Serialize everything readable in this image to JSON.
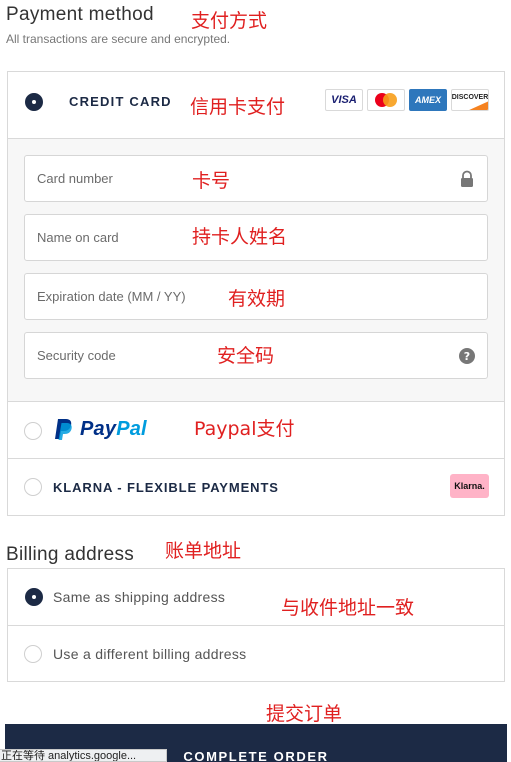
{
  "payment": {
    "title": "Payment method",
    "subtitle": "All transactions are secure and encrypted.",
    "credit_card": {
      "label": "CREDIT CARD",
      "selected": true,
      "logos": [
        {
          "name": "VISA",
          "color": "#1a1f71"
        },
        {
          "name": "mastercard",
          "color": "#eb001b"
        },
        {
          "name": "AMEX",
          "color": "#2e77bc"
        },
        {
          "name": "DISCOVER",
          "color": "#f58220"
        }
      ],
      "fields": {
        "card_number": {
          "placeholder": "Card number",
          "icon": "lock-icon"
        },
        "name_on_card": {
          "placeholder": "Name on card"
        },
        "expiration": {
          "placeholder": "Expiration date (MM / YY)"
        },
        "security_code": {
          "placeholder": "Security code",
          "icon": "help-icon"
        }
      }
    },
    "paypal": {
      "label_pay": "Pay",
      "label_pal": "Pal",
      "selected": false
    },
    "klarna": {
      "label": "KLARNA - FLEXIBLE PAYMENTS",
      "badge": "Klarna.",
      "selected": false
    }
  },
  "billing": {
    "title": "Billing address",
    "options": [
      {
        "label": "Same as shipping address",
        "selected": true
      },
      {
        "label": "Use a different billing address",
        "selected": false
      }
    ]
  },
  "submit": {
    "label": "COMPLETE ORDER"
  },
  "status_bar": {
    "text": "正在等待 analytics.google..."
  },
  "annotations": {
    "payment_method": "支付方式",
    "credit_card": "信用卡支付",
    "card_number": "卡号",
    "name_on_card": "持卡人姓名",
    "expiration": "有效期",
    "security_code": "安全码",
    "paypal": "Paypal支付",
    "billing_address": "账单地址",
    "same_as_shipping": "与收件地址一致",
    "submit": "提交订单"
  },
  "colors": {
    "navy": "#1c2a45",
    "annotation": "#e02020",
    "border": "#d9d9d9"
  }
}
